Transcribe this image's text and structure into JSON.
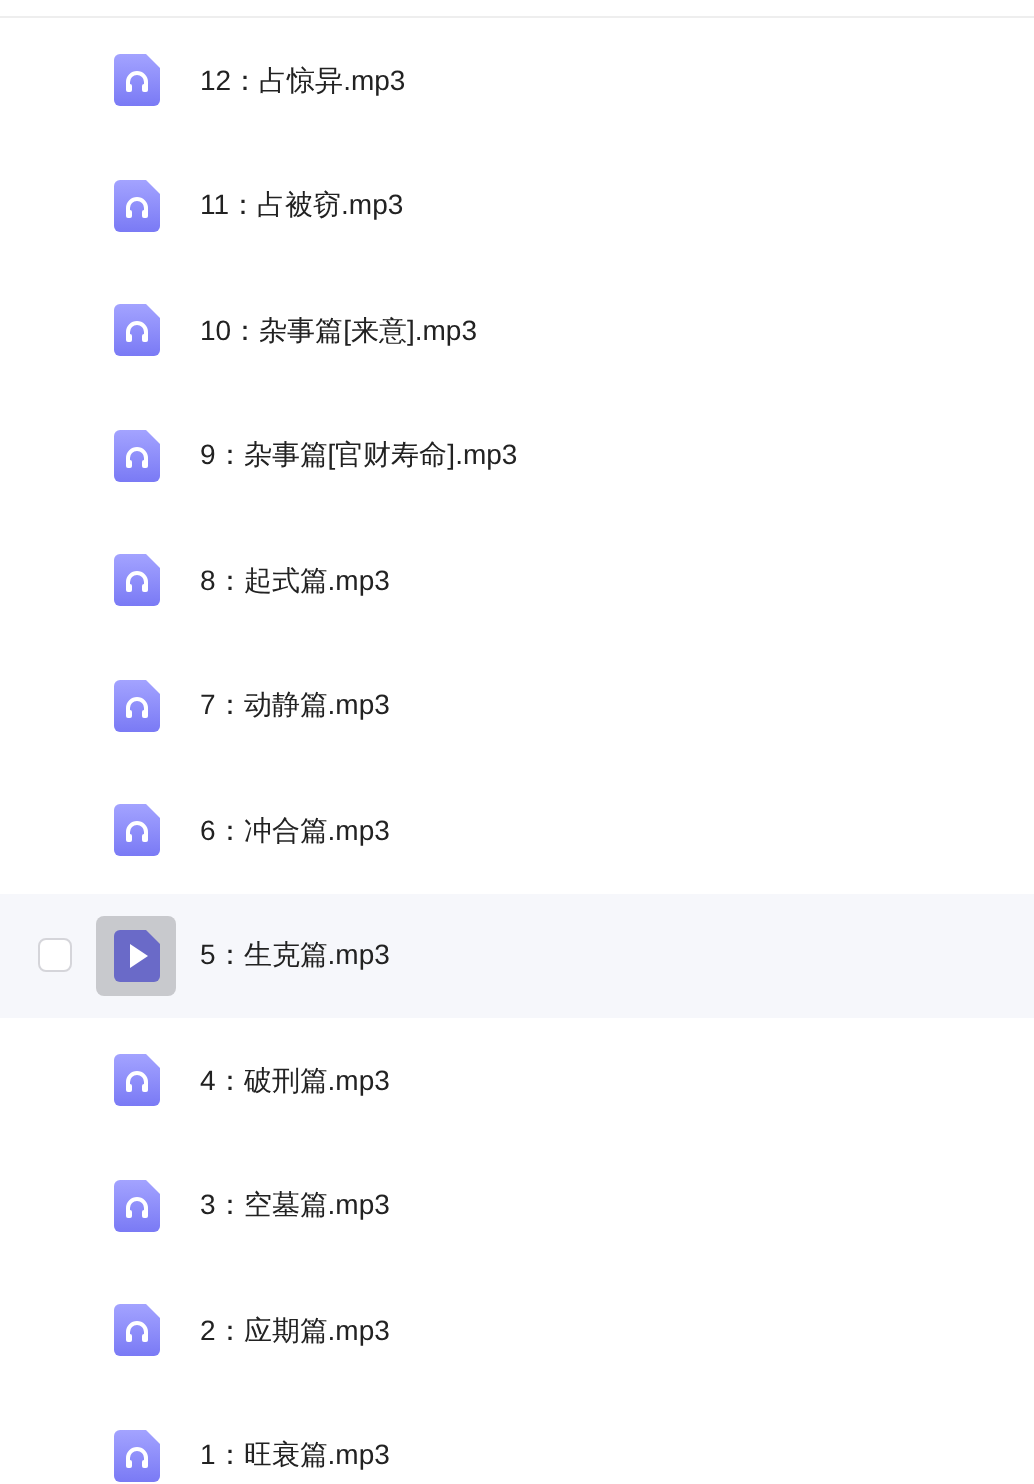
{
  "files": [
    {
      "name": "12：占惊异.mp3",
      "hovered": false
    },
    {
      "name": "11：占被窃.mp3",
      "hovered": false
    },
    {
      "name": "10：杂事篇[来意].mp3",
      "hovered": false
    },
    {
      "name": "9：杂事篇[官财寿命].mp3",
      "hovered": false
    },
    {
      "name": "8：起式篇.mp3",
      "hovered": false
    },
    {
      "name": "7：动静篇.mp3",
      "hovered": false
    },
    {
      "name": "6：冲合篇.mp3",
      "hovered": false
    },
    {
      "name": "5：生克篇.mp3",
      "hovered": true
    },
    {
      "name": "4：破刑篇.mp3",
      "hovered": false
    },
    {
      "name": "3：空墓篇.mp3",
      "hovered": false
    },
    {
      "name": "2：应期篇.mp3",
      "hovered": false
    },
    {
      "name": "1：旺衰篇.mp3",
      "hovered": false
    }
  ]
}
